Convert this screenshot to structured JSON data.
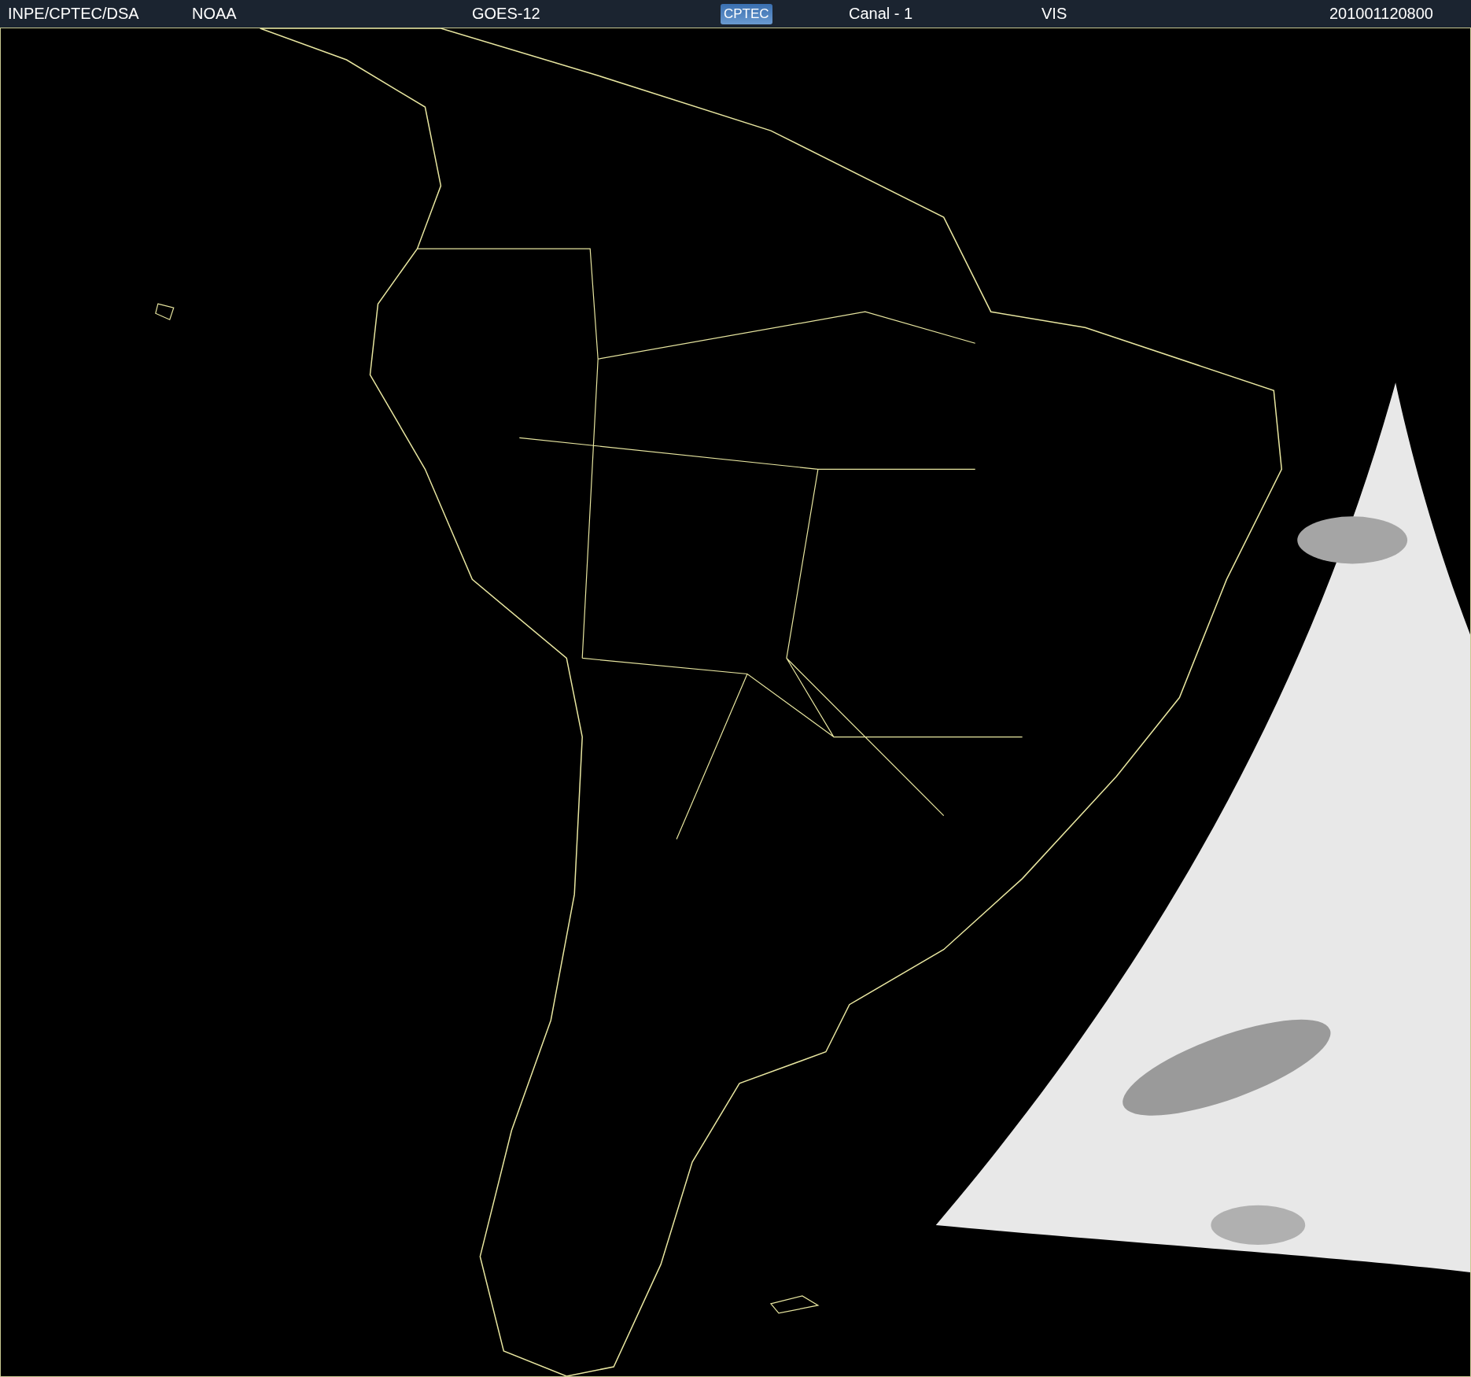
{
  "header": {
    "source": "INPE/CPTEC/DSA",
    "agency": "NOAA",
    "satellite": "GOES-12",
    "logo": "CPTEC",
    "channel": "Canal - 1",
    "band": "VIS",
    "timestamp": "201001120800"
  }
}
